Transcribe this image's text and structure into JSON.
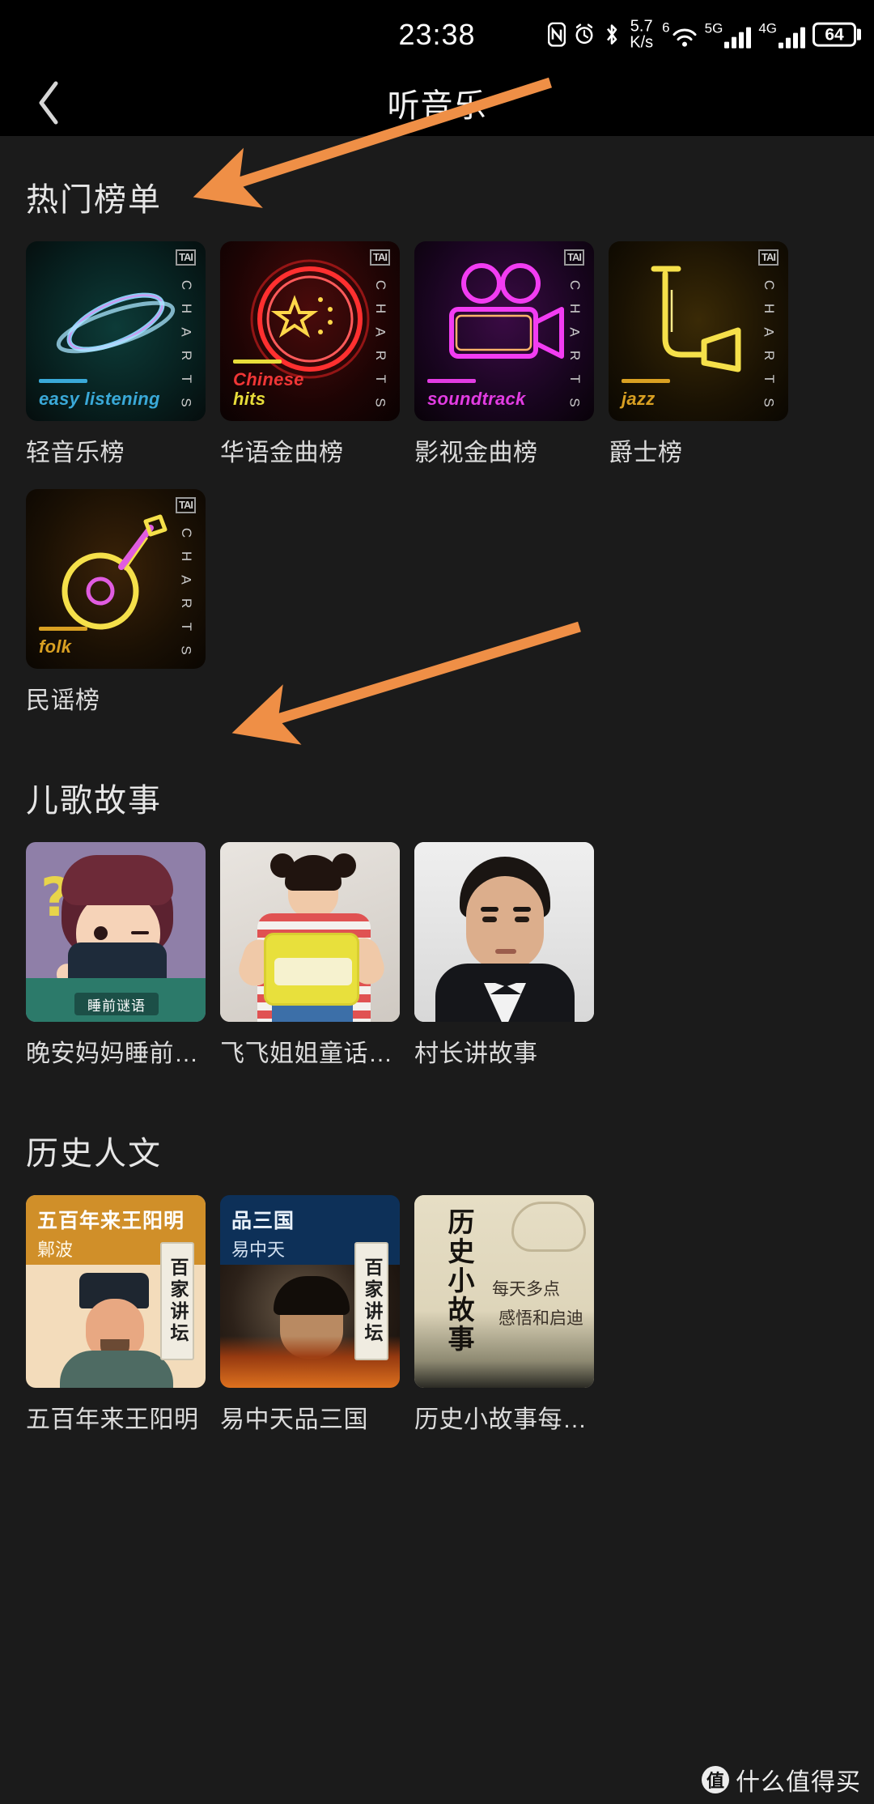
{
  "statusbar": {
    "time": "23:38",
    "net_speed_value": "5.7",
    "net_speed_unit": "K/s",
    "wifi_gen": "6",
    "sim1_label": "5G",
    "sim2_label": "4G",
    "battery": "64",
    "icons": [
      "nfc-icon",
      "alarm-icon",
      "bluetooth-icon",
      "wifi-icon",
      "signal-icon",
      "battery-icon"
    ]
  },
  "appbar": {
    "back_label": "‹",
    "title": "听音乐"
  },
  "sections": [
    {
      "title": "热门榜单",
      "kind": "charts",
      "items": [
        {
          "label": "轻音乐榜",
          "genre": "easy listening",
          "badge": "TAI",
          "vertical": "CHARTS",
          "accent": "#3aa9d8"
        },
        {
          "label": "华语金曲榜",
          "genre_line1": "Chinese",
          "genre_line2": "hits",
          "badge": "TAI",
          "vertical": "CHARTS",
          "accent": "#e8dd3a"
        },
        {
          "label": "影视金曲榜",
          "genre": "soundtrack",
          "badge": "TAI",
          "vertical": "CHARTS",
          "accent": "#e23ce2"
        },
        {
          "label": "爵士榜",
          "genre": "jazz",
          "badge": "TAI",
          "vertical": "CHARTS",
          "accent": "#d9a022"
        },
        {
          "label": "民谣榜",
          "genre": "folk",
          "badge": "TAI",
          "vertical": "CHARTS",
          "accent": "#d9a022"
        }
      ]
    },
    {
      "title": "儿歌故事",
      "kind": "kids",
      "items": [
        {
          "label": "晚安妈妈睡前谜语",
          "cover_text": "睡前谜语"
        },
        {
          "label": "飞飞姐姐童话故事集"
        },
        {
          "label": "村长讲故事"
        }
      ]
    },
    {
      "title": "历史人文",
      "kind": "history",
      "items": [
        {
          "label": "五百年来王阳明",
          "cover_title": "五百年来王阳明",
          "cover_author": "鄡波",
          "series": "百家讲坛"
        },
        {
          "label": "易中天品三国",
          "cover_title": "品三国",
          "cover_author": "易中天",
          "series": "百家讲坛"
        },
        {
          "label": "历史小故事每天多...",
          "cover_title": "历史小故事",
          "cover_sub1": "每天多点",
          "cover_sub2": "感悟和启迪"
        }
      ]
    }
  ],
  "annotations": {
    "arrow_color": "#ef8f46",
    "arrow1_name": "arrow-pointing-to-popular-charts",
    "arrow2_name": "arrow-pointing-to-kids-stories"
  },
  "watermark": {
    "badge": "值",
    "text": "什么值得买"
  }
}
